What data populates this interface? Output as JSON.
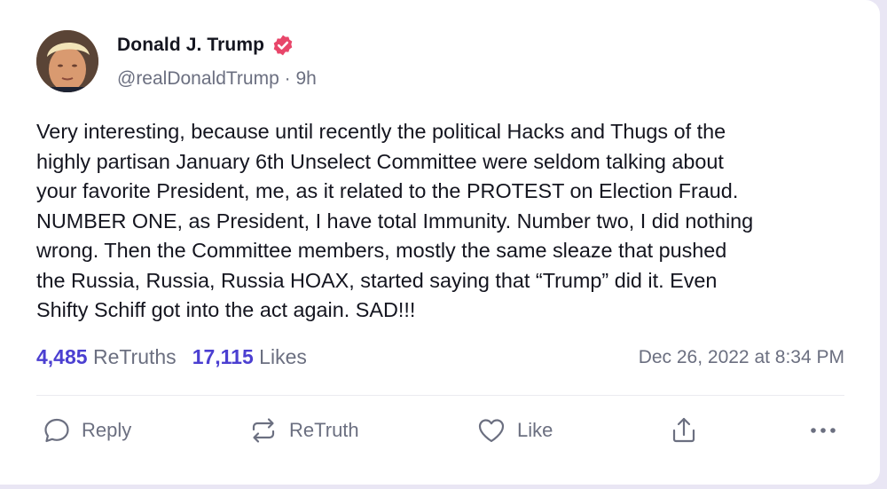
{
  "author": {
    "name": "Donald J. Trump",
    "handle": "@realDonaldTrump",
    "separator": "·",
    "age": "9h"
  },
  "post": {
    "text": "Very interesting, because until recently the political Hacks and Thugs of the\nhighly partisan January 6th Unselect Committee were seldom talking about\nyour favorite President, me, as it related to the PROTEST on Election Fraud.\nNUMBER ONE, as President, I have total Immunity. Number two, I did nothing\nwrong. Then the Committee members, mostly the same sleaze that pushed\nthe Russia, Russia, Russia HOAX, started saying that “Trump” did it. Even\nShifty Schiff got into the act again. SAD!!!"
  },
  "stats": {
    "retruths_count": "4,485",
    "retruths_label": "ReTruths",
    "likes_count": "17,115",
    "likes_label": "Likes"
  },
  "timestamp": "Dec 26, 2022 at 8:34 PM",
  "actions": {
    "reply": "Reply",
    "retruth": "ReTruth",
    "like": "Like"
  },
  "icons": {
    "verified": "verified-badge-icon",
    "reply": "speech-bubble-icon",
    "retruth": "repost-arrows-icon",
    "like": "heart-icon",
    "share": "share-upload-icon",
    "more": "ellipsis-icon"
  },
  "colors": {
    "accent": "#4b3fd1",
    "verified": "#e8466a",
    "muted": "#6b6f80",
    "text": "#14151f",
    "background": "#e9e6f4"
  }
}
